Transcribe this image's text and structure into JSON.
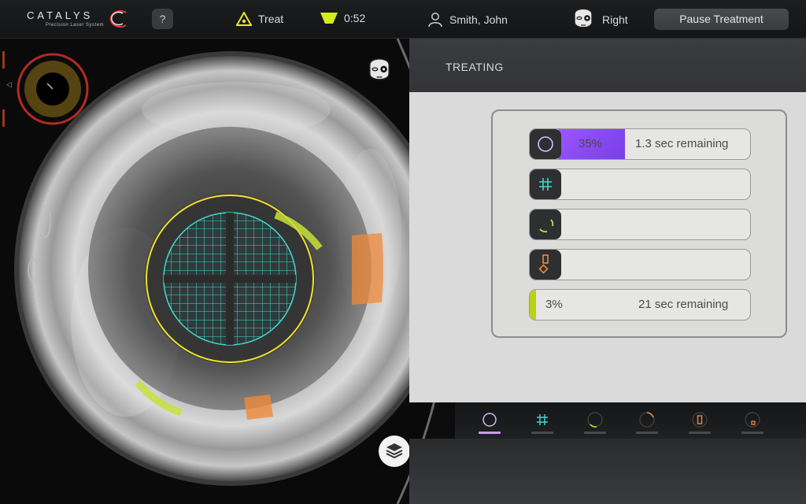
{
  "header": {
    "logo_text": "CATALYS",
    "logo_subtitle": "Precision Laser System",
    "help_label": "?",
    "mode_label": "Treat",
    "timer": "0:52",
    "patient_name": "Smith, John",
    "eye_label": "Right",
    "pause_label": "Pause Treatment",
    "icons": {
      "mode": "warning-triangle-icon",
      "timer": "funnel-timer-icon",
      "patient": "person-icon",
      "eye": "face-eye-icon"
    }
  },
  "video": {
    "gauge_marker": "◁",
    "icons": {
      "eye_toggle": "face-eye-icon",
      "layers": "layers-icon"
    }
  },
  "panel": {
    "title": "TREATING",
    "steps": [
      {
        "icon": "circle-icon",
        "percent": 35,
        "percent_label": "35%",
        "remaining": "1.3 sec remaining",
        "color": "#9b57ff"
      },
      {
        "icon": "grid-icon",
        "percent_label": "",
        "remaining": ""
      },
      {
        "icon": "arc-incision-icon",
        "percent_label": "",
        "remaining": ""
      },
      {
        "icon": "side-port-icon",
        "percent_label": "",
        "remaining": ""
      },
      {
        "icon": "total-progress",
        "percent": 3,
        "percent_label": "3%",
        "remaining": "21 sec remaining",
        "color": "#b8d30f"
      }
    ],
    "nav": [
      {
        "icon": "circle-icon",
        "active": true
      },
      {
        "icon": "grid-icon",
        "active": false
      },
      {
        "icon": "arc-incision-icon",
        "active": false
      },
      {
        "icon": "arc-dotted-icon",
        "active": false
      },
      {
        "icon": "side-port-icon",
        "active": false
      },
      {
        "icon": "circle-port-icon",
        "active": false
      }
    ]
  },
  "colors": {
    "capsulotomy": "#f0e22a",
    "grid": "#3fd9d0",
    "arc_incision": "#c8e03a",
    "side_port": "#f08a3a",
    "progress_purple": "#9b57ff"
  }
}
